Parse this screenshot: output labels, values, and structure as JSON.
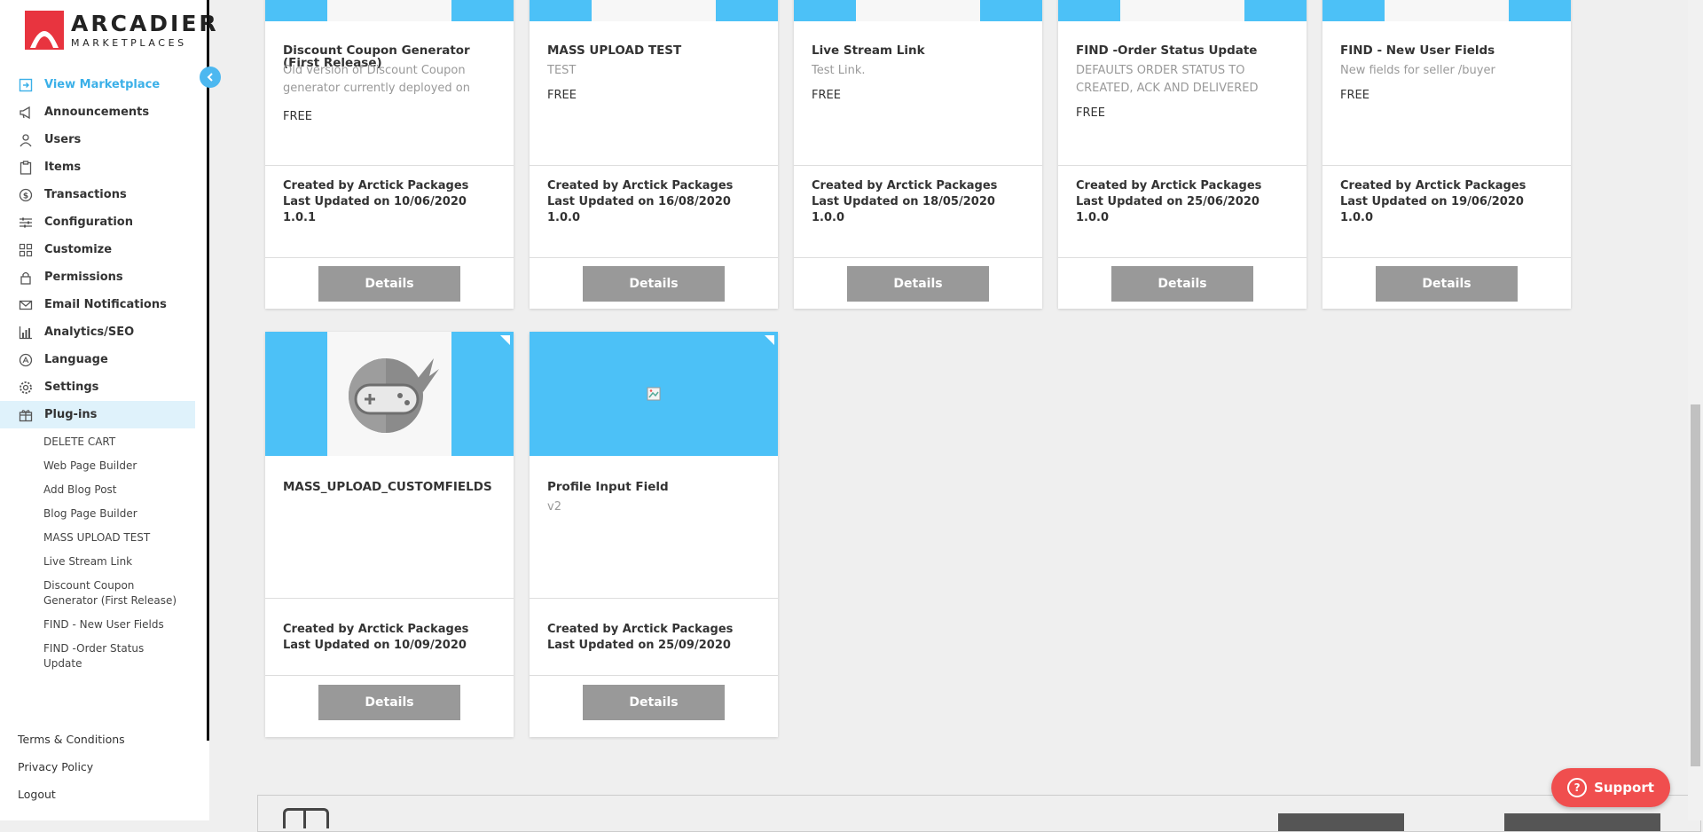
{
  "brand": {
    "name": "ARCADIER",
    "sub": "MARKETPLACES",
    "accent": "#4cc1f7",
    "support_color": "#f04e4e"
  },
  "sidebar": {
    "items": [
      {
        "label": "View Marketplace",
        "icon": "external-link-icon"
      },
      {
        "label": "Announcements",
        "icon": "megaphone-icon"
      },
      {
        "label": "Users",
        "icon": "user-icon"
      },
      {
        "label": "Items",
        "icon": "clipboard-icon"
      },
      {
        "label": "Transactions",
        "icon": "dollar-icon"
      },
      {
        "label": "Configuration",
        "icon": "sliders-icon"
      },
      {
        "label": "Customize",
        "icon": "grid-icon"
      },
      {
        "label": "Permissions",
        "icon": "lock-icon"
      },
      {
        "label": "Email Notifications",
        "icon": "mail-icon"
      },
      {
        "label": "Analytics/SEO",
        "icon": "bar-chart-icon"
      },
      {
        "label": "Language",
        "icon": "language-icon"
      },
      {
        "label": "Settings",
        "icon": "gear-icon"
      },
      {
        "label": "Plug-ins",
        "icon": "gift-icon"
      }
    ],
    "plugins": [
      "DELETE CART",
      "Web Page Builder",
      "Add Blog Post",
      "Blog Page Builder",
      "MASS UPLOAD TEST",
      "Live Stream Link",
      "Discount Coupon Generator (First Release)",
      "FIND - New User Fields",
      "FIND -Order Status Update"
    ],
    "footer": [
      "Terms & Conditions",
      "Privacy Policy",
      "Logout"
    ]
  },
  "cards_row1": [
    {
      "title": "Discount Coupon Generator (First Release)",
      "desc": "Old version of Discount Coupon generator currently deployed on",
      "price": "FREE",
      "created": "Created by Arctick Packages",
      "updated": "Last Updated on 10/06/2020",
      "version": "1.0.1",
      "button": "Details"
    },
    {
      "title": "MASS UPLOAD TEST",
      "desc": "TEST",
      "price": "FREE",
      "created": "Created by Arctick Packages",
      "updated": "Last Updated on 16/08/2020",
      "version": "1.0.0",
      "button": "Details"
    },
    {
      "title": "Live Stream Link",
      "desc": "Test Link.",
      "price": "FREE",
      "created": "Created by Arctick Packages",
      "updated": "Last Updated on 18/05/2020",
      "version": "1.0.0",
      "button": "Details"
    },
    {
      "title": "FIND -Order Status Update",
      "desc": "DEFAULTS ORDER STATUS TO CREATED, ACK AND DELIVERED",
      "price": "FREE",
      "created": "Created by Arctick Packages",
      "updated": "Last Updated on 25/06/2020",
      "version": "1.0.0",
      "button": "Details"
    },
    {
      "title": "FIND - New User Fields",
      "desc": "New fields for seller /buyer",
      "price": "FREE",
      "created": "Created by Arctick Packages",
      "updated": "Last Updated on 19/06/2020",
      "version": "1.0.0",
      "button": "Details"
    }
  ],
  "cards_row2": [
    {
      "title": "MASS_UPLOAD_CUSTOMFIELDS",
      "desc": "",
      "created": "Created by Arctick Packages",
      "updated": "Last Updated on 10/09/2020",
      "button": "Details",
      "image": "ninja-gamer-icon"
    },
    {
      "title": "Profile Input Field",
      "desc": "v2",
      "created": "Created by Arctick Packages",
      "updated": "Last Updated on 25/09/2020",
      "button": "Details",
      "image": "broken-image-icon"
    }
  ],
  "support": {
    "label": "Support"
  }
}
